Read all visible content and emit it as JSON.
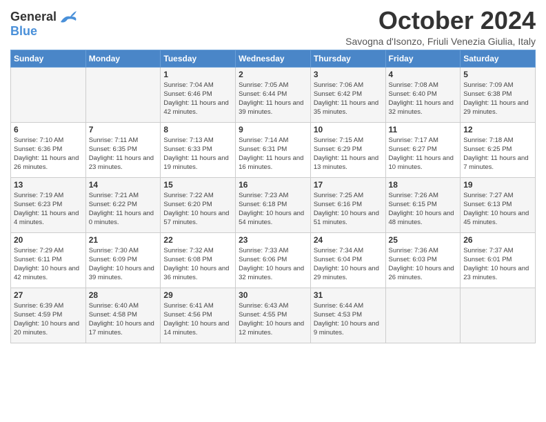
{
  "logo": {
    "line1": "General",
    "line2": "Blue"
  },
  "title": "October 2024",
  "subtitle": "Savogna d'Isonzo, Friuli Venezia Giulia, Italy",
  "days_of_week": [
    "Sunday",
    "Monday",
    "Tuesday",
    "Wednesday",
    "Thursday",
    "Friday",
    "Saturday"
  ],
  "weeks": [
    [
      {
        "day": "",
        "info": ""
      },
      {
        "day": "",
        "info": ""
      },
      {
        "day": "1",
        "info": "Sunrise: 7:04 AM\nSunset: 6:46 PM\nDaylight: 11 hours and 42 minutes."
      },
      {
        "day": "2",
        "info": "Sunrise: 7:05 AM\nSunset: 6:44 PM\nDaylight: 11 hours and 39 minutes."
      },
      {
        "day": "3",
        "info": "Sunrise: 7:06 AM\nSunset: 6:42 PM\nDaylight: 11 hours and 35 minutes."
      },
      {
        "day": "4",
        "info": "Sunrise: 7:08 AM\nSunset: 6:40 PM\nDaylight: 11 hours and 32 minutes."
      },
      {
        "day": "5",
        "info": "Sunrise: 7:09 AM\nSunset: 6:38 PM\nDaylight: 11 hours and 29 minutes."
      }
    ],
    [
      {
        "day": "6",
        "info": "Sunrise: 7:10 AM\nSunset: 6:36 PM\nDaylight: 11 hours and 26 minutes."
      },
      {
        "day": "7",
        "info": "Sunrise: 7:11 AM\nSunset: 6:35 PM\nDaylight: 11 hours and 23 minutes."
      },
      {
        "day": "8",
        "info": "Sunrise: 7:13 AM\nSunset: 6:33 PM\nDaylight: 11 hours and 19 minutes."
      },
      {
        "day": "9",
        "info": "Sunrise: 7:14 AM\nSunset: 6:31 PM\nDaylight: 11 hours and 16 minutes."
      },
      {
        "day": "10",
        "info": "Sunrise: 7:15 AM\nSunset: 6:29 PM\nDaylight: 11 hours and 13 minutes."
      },
      {
        "day": "11",
        "info": "Sunrise: 7:17 AM\nSunset: 6:27 PM\nDaylight: 11 hours and 10 minutes."
      },
      {
        "day": "12",
        "info": "Sunrise: 7:18 AM\nSunset: 6:25 PM\nDaylight: 11 hours and 7 minutes."
      }
    ],
    [
      {
        "day": "13",
        "info": "Sunrise: 7:19 AM\nSunset: 6:23 PM\nDaylight: 11 hours and 4 minutes."
      },
      {
        "day": "14",
        "info": "Sunrise: 7:21 AM\nSunset: 6:22 PM\nDaylight: 11 hours and 0 minutes."
      },
      {
        "day": "15",
        "info": "Sunrise: 7:22 AM\nSunset: 6:20 PM\nDaylight: 10 hours and 57 minutes."
      },
      {
        "day": "16",
        "info": "Sunrise: 7:23 AM\nSunset: 6:18 PM\nDaylight: 10 hours and 54 minutes."
      },
      {
        "day": "17",
        "info": "Sunrise: 7:25 AM\nSunset: 6:16 PM\nDaylight: 10 hours and 51 minutes."
      },
      {
        "day": "18",
        "info": "Sunrise: 7:26 AM\nSunset: 6:15 PM\nDaylight: 10 hours and 48 minutes."
      },
      {
        "day": "19",
        "info": "Sunrise: 7:27 AM\nSunset: 6:13 PM\nDaylight: 10 hours and 45 minutes."
      }
    ],
    [
      {
        "day": "20",
        "info": "Sunrise: 7:29 AM\nSunset: 6:11 PM\nDaylight: 10 hours and 42 minutes."
      },
      {
        "day": "21",
        "info": "Sunrise: 7:30 AM\nSunset: 6:09 PM\nDaylight: 10 hours and 39 minutes."
      },
      {
        "day": "22",
        "info": "Sunrise: 7:32 AM\nSunset: 6:08 PM\nDaylight: 10 hours and 36 minutes."
      },
      {
        "day": "23",
        "info": "Sunrise: 7:33 AM\nSunset: 6:06 PM\nDaylight: 10 hours and 32 minutes."
      },
      {
        "day": "24",
        "info": "Sunrise: 7:34 AM\nSunset: 6:04 PM\nDaylight: 10 hours and 29 minutes."
      },
      {
        "day": "25",
        "info": "Sunrise: 7:36 AM\nSunset: 6:03 PM\nDaylight: 10 hours and 26 minutes."
      },
      {
        "day": "26",
        "info": "Sunrise: 7:37 AM\nSunset: 6:01 PM\nDaylight: 10 hours and 23 minutes."
      }
    ],
    [
      {
        "day": "27",
        "info": "Sunrise: 6:39 AM\nSunset: 4:59 PM\nDaylight: 10 hours and 20 minutes."
      },
      {
        "day": "28",
        "info": "Sunrise: 6:40 AM\nSunset: 4:58 PM\nDaylight: 10 hours and 17 minutes."
      },
      {
        "day": "29",
        "info": "Sunrise: 6:41 AM\nSunset: 4:56 PM\nDaylight: 10 hours and 14 minutes."
      },
      {
        "day": "30",
        "info": "Sunrise: 6:43 AM\nSunset: 4:55 PM\nDaylight: 10 hours and 12 minutes."
      },
      {
        "day": "31",
        "info": "Sunrise: 6:44 AM\nSunset: 4:53 PM\nDaylight: 10 hours and 9 minutes."
      },
      {
        "day": "",
        "info": ""
      },
      {
        "day": "",
        "info": ""
      }
    ]
  ]
}
